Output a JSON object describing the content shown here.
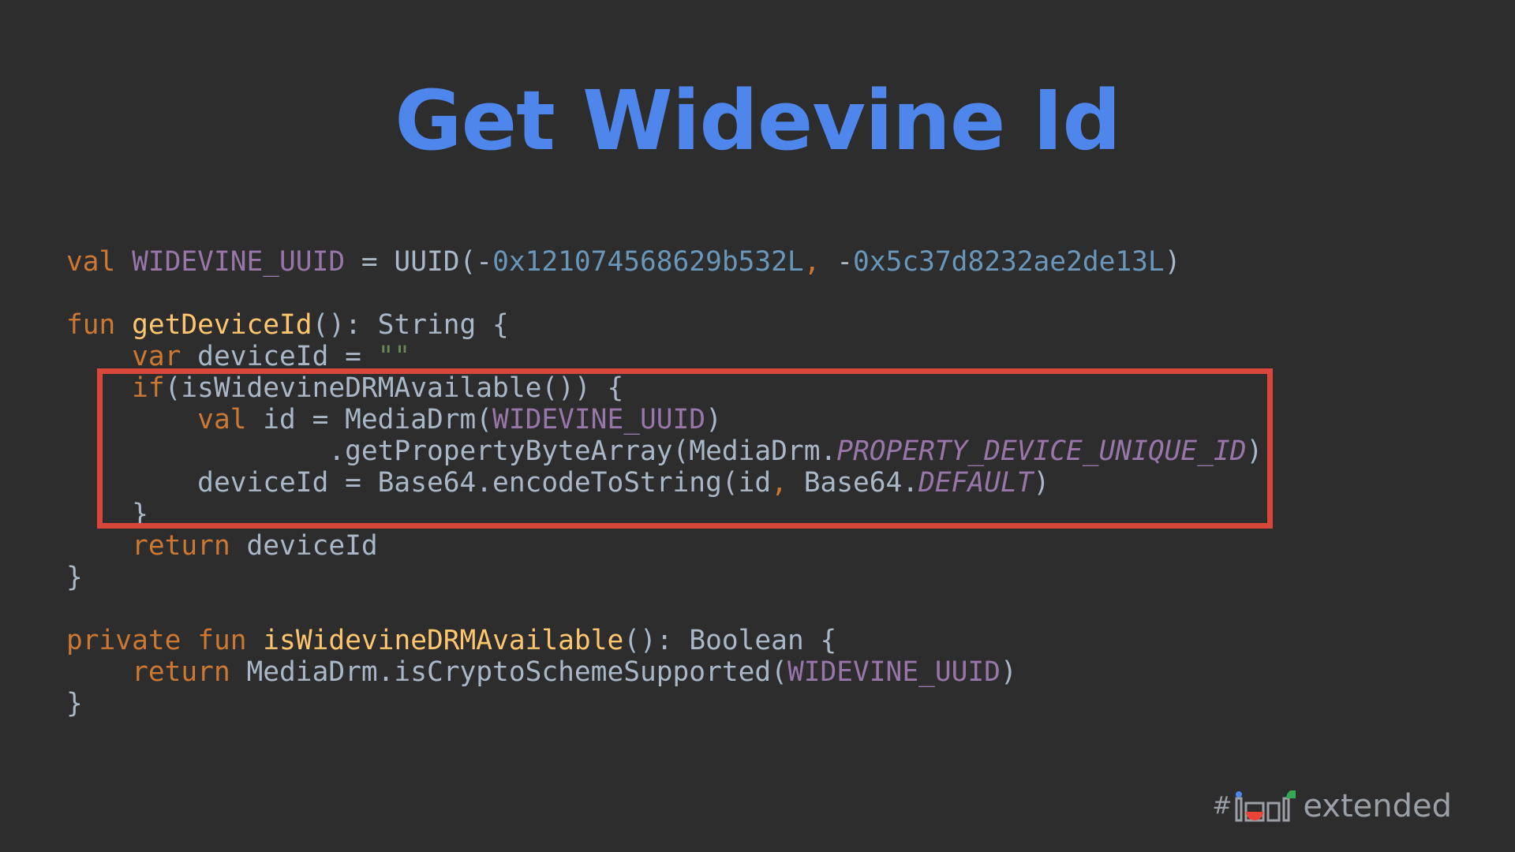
{
  "slide": {
    "title": "Get Widevine Id"
  },
  "code": {
    "l1": {
      "kw": "val",
      "name": "WIDEVINE_UUID",
      "eq": " = UUID(-",
      "n1": "0x121074568629b532L",
      "comma": ",",
      "sp": " -",
      "n2": "0x5c37d8232ae2de13L",
      "end": ")"
    },
    "l3": {
      "kw": "fun",
      "fn": "getDeviceId",
      "rest": "(): String {"
    },
    "l4": {
      "indent": "    ",
      "kw": "var",
      "rest": " deviceId = ",
      "str": "\"\""
    },
    "l5": {
      "indent": "    ",
      "kw": "if",
      "rest": "(isWidevineDRMAvailable()) {"
    },
    "l6": {
      "indent": "        ",
      "kw": "val",
      "rest": " id = MediaDrm(",
      "c": "WIDEVINE_UUID",
      "end": ")"
    },
    "l7": {
      "indent": "                ",
      "rest": ".getPropertyByteArray(MediaDrm.",
      "c": "PROPERTY_DEVICE_UNIQUE_ID",
      "end": ")"
    },
    "l8": {
      "indent": "        ",
      "rest": "deviceId = Base64.encodeToString(id",
      "comma": ",",
      "rest2": " Base64.",
      "c": "DEFAULT",
      "end": ")"
    },
    "l9": {
      "indent": "    ",
      "rest": "}"
    },
    "l10": {
      "indent": "    ",
      "kw": "return",
      "rest": " deviceId"
    },
    "l11": {
      "rest": "}"
    },
    "l13": {
      "kw1": "private",
      "kw2": "fun",
      "fn": "isWidevineDRMAvailable",
      "rest": "(): Boolean {"
    },
    "l14": {
      "indent": "    ",
      "kw": "return",
      "rest": " MediaDrm.isCryptoSchemeSupported(",
      "c": "WIDEVINE_UUID",
      "end": ")"
    },
    "l15": {
      "rest": "}"
    }
  },
  "logo": {
    "hash": "#",
    "word": "extended"
  },
  "colors": {
    "background": "#2d2d2d",
    "title": "#4f86ec",
    "keyword": "#cc7832",
    "function": "#ffc66d",
    "constant": "#9876aa",
    "number": "#6897bb",
    "string": "#6a8759",
    "text": "#a9b7c6",
    "highlight": "#d9473a"
  }
}
